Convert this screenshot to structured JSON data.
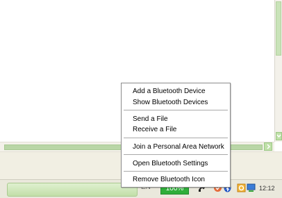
{
  "menu": {
    "items": [
      "Add a Bluetooth Device",
      "Show Bluetooth Devices",
      "Send a File",
      "Receive a File",
      "Join a Personal Area Network",
      "Open Bluetooth Settings",
      "Remove Bluetooth Icon"
    ]
  },
  "tray": {
    "language": "EN",
    "battery": "100%",
    "clock": "12:12",
    "icons": [
      "network-icon",
      "shield-icon",
      "bluetooth-icon",
      "antivirus-icon",
      "monitor-icon"
    ]
  },
  "colors": {
    "battery_bg": "#2fae3a",
    "scroll_green": "#bfe0a8",
    "taskbar": "#eae8dc"
  }
}
